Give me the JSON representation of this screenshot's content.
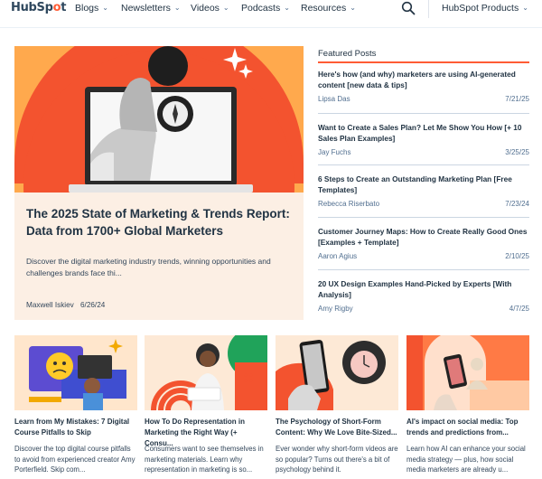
{
  "nav": {
    "logo_prefix": "HubSp",
    "logo_dot": "o",
    "logo_suffix": "t",
    "items": [
      "Blogs",
      "Newsletters",
      "Videos",
      "Podcasts",
      "Resources"
    ],
    "products": "HubSpot Products",
    "icons": {
      "search": "search-icon",
      "chevron": "chevron-down-icon"
    }
  },
  "colors": {
    "accent": "#ff5c35",
    "hero_bg": "#fcefe4",
    "hero_img": "#ffa94d",
    "text": "#213343"
  },
  "hero": {
    "title": "The 2025 State of Marketing & Trends Report: Data from 1700+ Global Marketers",
    "description": "Discover the digital marketing industry trends, winning opportunities and challenges brands face thi...",
    "author": "Maxwell Iskiev",
    "date": "6/26/24"
  },
  "featured": {
    "heading": "Featured Posts",
    "posts": [
      {
        "title": "Here's how (and why) marketers are using AI-generated content [new data & tips]",
        "author": "Lipsa Das",
        "date": "7/21/25"
      },
      {
        "title": "Want to Create a Sales Plan? Let Me Show You How [+ 10 Sales Plan Examples]",
        "author": "Jay Fuchs",
        "date": "3/25/25"
      },
      {
        "title": "6 Steps to Create an Outstanding Marketing Plan [Free Templates]",
        "author": "Rebecca Riserbato",
        "date": "7/23/24"
      },
      {
        "title": "Customer Journey Maps: How to Create Really Good Ones [Examples + Template]",
        "author": "Aaron Agius",
        "date": "2/10/25"
      },
      {
        "title": "20 UX Design Examples Hand-Picked by Experts [With Analysis]",
        "author": "Amy Rigby",
        "date": "4/7/25"
      }
    ]
  },
  "cards": [
    {
      "title": "Learn from My Mistakes: 7 Digital Course Pitfalls to Skip",
      "description": "Discover the top digital course pitfalls to avoid from experienced creator Amy Porterfield. Skip com..."
    },
    {
      "title": "How To Do Representation in Marketing the Right Way (+ Consu...",
      "description": "Consumers want to see themselves in marketing materials. Learn why representation in marketing is so..."
    },
    {
      "title": "The Psychology of Short-Form Content: Why We Love Bite-Sized...",
      "description": "Ever wonder why short-form videos are so popular? Turns out there's a bit of psychology behind it."
    },
    {
      "title": "AI's impact on social media: Top trends and predictions from...",
      "description": "Learn how AI can enhance your social media strategy — plus, how social media marketers are already u..."
    }
  ]
}
